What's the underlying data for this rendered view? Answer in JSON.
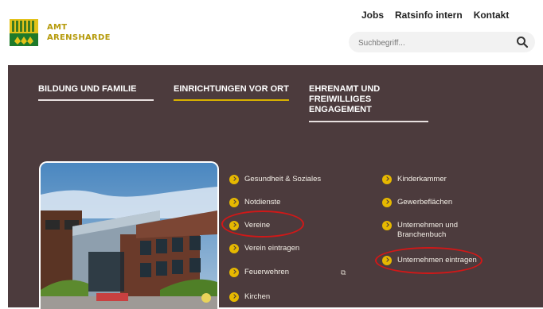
{
  "header": {
    "logo": {
      "line1": "AMT",
      "line2": "ARENSHARDE"
    },
    "topnav": [
      "Jobs",
      "Ratsinfo intern",
      "Kontakt"
    ],
    "search": {
      "placeholder": "Suchbegriff...",
      "icon": "search-icon"
    }
  },
  "menu": {
    "columns": [
      {
        "label": "BILDUNG UND FAMILIE"
      },
      {
        "label": "EINRICHTUNGEN VOR ORT"
      },
      {
        "label": "EHRENAMT UND FREIWILLIGES ENGAGEMENT"
      }
    ],
    "list_left": [
      "Gesundheit & Soziales",
      "Notdienste",
      "Vereine",
      "Verein eintragen",
      "Feuerwehren",
      "Kirchen"
    ],
    "list_right": [
      "Kinderkammer",
      "Gewerbeflächen",
      "Unternehmen und Branchenbuch",
      "Unternehmen eintragen"
    ]
  },
  "colors": {
    "menu_bg": "#4c3b3d",
    "accent": "#e6b800",
    "brand_green": "#1f7a2a",
    "logo_gold": "#b59a0a",
    "highlight": "#d01818"
  }
}
